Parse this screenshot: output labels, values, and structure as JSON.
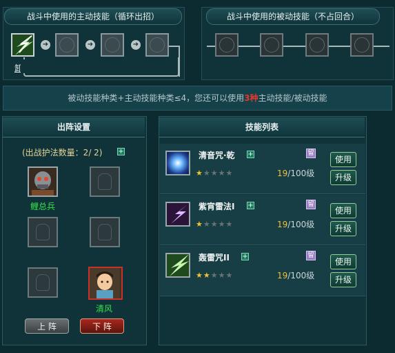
{
  "active_skills": {
    "title": "战斗中使用的主动技能（循环出招）",
    "slot_label": "卸除"
  },
  "passive_skills": {
    "title": "战斗中使用的被动技能（不占回合）"
  },
  "info": {
    "prefix": "被动技能种类+主动技能种类≤4，您还可以使用",
    "highlight": "3种",
    "suffix": "主动技能/被动技能",
    "highlight_color": "#e03a2a"
  },
  "formation": {
    "title": "出阵设置",
    "count_label": "(出战护法数量：2/ 2)",
    "guardians": [
      {
        "name": "鲤总兵"
      },
      {
        "name": "清风"
      }
    ],
    "up_button": "上 阵",
    "down_button": "下 阵"
  },
  "skill_list": {
    "title": "技能列表",
    "use_label": "使用",
    "upgrade_label": "升级",
    "badge": "留",
    "skills": [
      {
        "name": "清音咒·乾",
        "stars": 1,
        "level": "19",
        "max": "/100级",
        "icon": "blue-orb-icon"
      },
      {
        "name": "紫宵雷法I",
        "stars": 1,
        "level": "19",
        "max": "/100级",
        "icon": "purple-lightning-icon"
      },
      {
        "name": "轰雷咒II",
        "stars": 2,
        "level": "19",
        "max": "/100级",
        "icon": "green-thunder-icon"
      }
    ]
  },
  "colors": {
    "background": "#0c2b30",
    "name_green": "#34e24a",
    "level_gold": "#f0c236"
  }
}
